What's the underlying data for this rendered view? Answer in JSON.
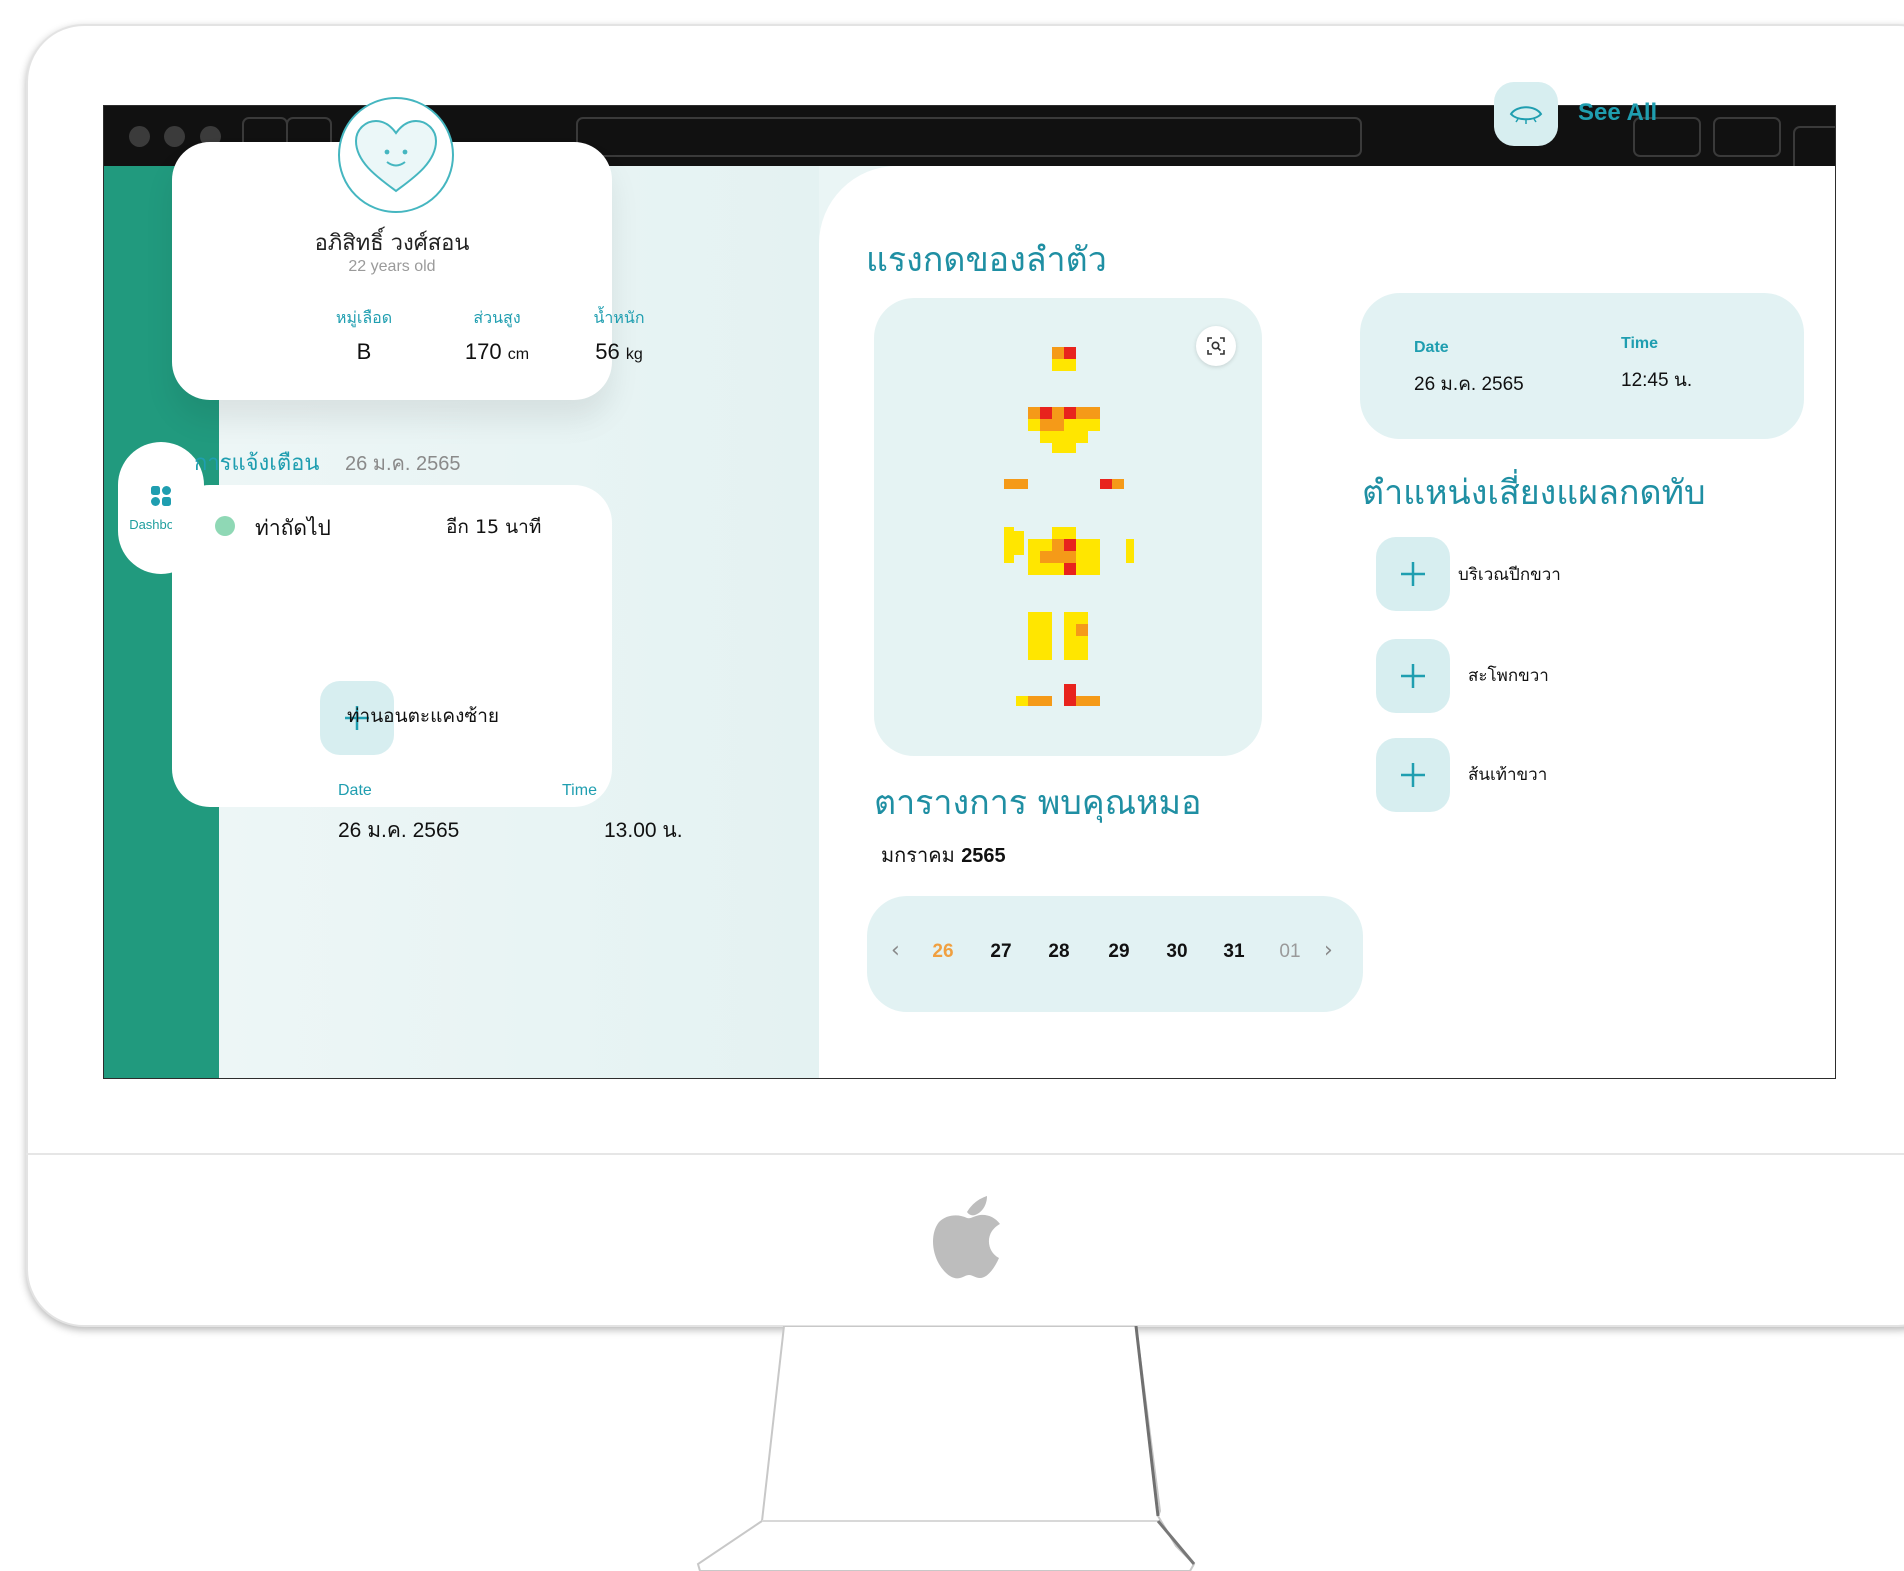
{
  "profile": {
    "name": "อภิสิทธิ์ วงศ์สอน",
    "age": "22 years old",
    "blood_label": "หมู่เลือด",
    "blood_value": "B",
    "height_label": "ส่วนสูง",
    "height_value": "170",
    "height_unit": "cm",
    "weight_label": "น้ำหนัก",
    "weight_value": "56",
    "weight_unit": "kg"
  },
  "sidebar": {
    "dashboard_label": "Dashboard"
  },
  "alerts": {
    "title": "การแจ้งเตือน",
    "date": "26 ม.ค. 2565",
    "next_label": "ท่าถัดไป",
    "next_time": "อีก 15 นาที",
    "position": "ท่านอนตะแคงซ้าย",
    "date_label": "Date",
    "date_value": "26 ม.ค. 2565",
    "time_label": "Time",
    "time_value": "13.00 น."
  },
  "pressure": {
    "title": "แรงกดของลำตัว",
    "see_all": "See All",
    "date_label": "Date",
    "date_value": "26 ม.ค. 2565",
    "time_label": "Time",
    "time_value": "12:45 น."
  },
  "risk": {
    "title": "ตำแหน่งเสี่ยงแผลกดทับ",
    "items": [
      "บริเวณปีกขวา",
      "สะโพกขวา",
      "ส้นเท้าขวา"
    ]
  },
  "schedule": {
    "title": "ตารางการ พบคุณหมอ",
    "month": "มกราคม",
    "year": "2565",
    "days": [
      "26",
      "27",
      "28",
      "29",
      "30",
      "31",
      "01"
    ],
    "selected_color": "#f0a040"
  },
  "colors": {
    "accent": "#1f9eb0",
    "rail": "#219a7e",
    "heat_red": "#e8231d",
    "heat_orange": "#f59a18",
    "heat_yellow": "#ffe600"
  }
}
